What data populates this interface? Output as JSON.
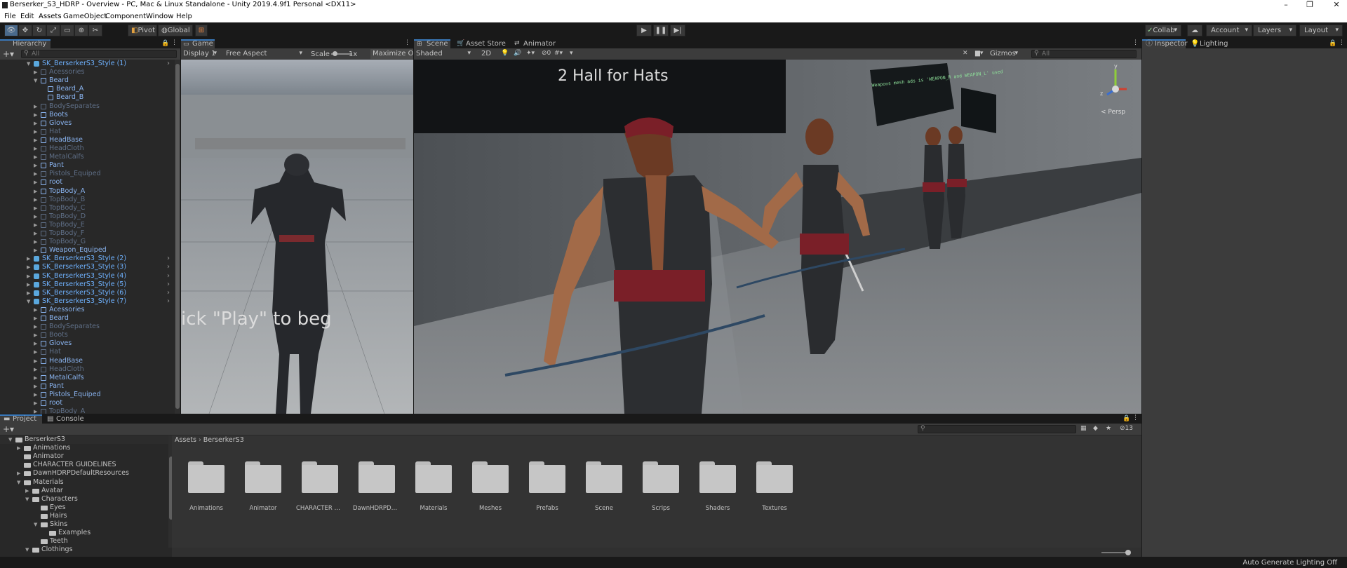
{
  "window": {
    "title": "Berserker_S3_HDRP - Overview - PC, Mac & Linux Standalone - Unity 2019.4.9f1 Personal <DX11>",
    "controls": [
      "–",
      "❐",
      "✕"
    ]
  },
  "menu": [
    "File",
    "Edit",
    "Assets",
    "GameObject",
    "Component",
    "Window",
    "Help"
  ],
  "toolbar": {
    "pivot": "Pivot",
    "global": "Global",
    "collab": "Collab",
    "account": "Account",
    "layers": "Layers",
    "layout": "Layout"
  },
  "hierarchy": {
    "tab": "Hierarchy",
    "search_placeholder": "All",
    "rows": [
      {
        "label": "SK_BerserkerS3_Style (1)",
        "depth": 0,
        "kind": "pre",
        "arrow": "open"
      },
      {
        "label": "Acessories",
        "depth": 1,
        "kind": "dis",
        "arrow": "closed"
      },
      {
        "label": "Beard",
        "depth": 1,
        "kind": "chi",
        "arrow": "open"
      },
      {
        "label": "Beard_A",
        "depth": 2,
        "kind": "chi",
        "arrow": ""
      },
      {
        "label": "Beard_B",
        "depth": 2,
        "kind": "chi",
        "arrow": ""
      },
      {
        "label": "BodySeparates",
        "depth": 1,
        "kind": "dis",
        "arrow": "closed"
      },
      {
        "label": "Boots",
        "depth": 1,
        "kind": "chi",
        "arrow": "closed"
      },
      {
        "label": "Gloves",
        "depth": 1,
        "kind": "chi",
        "arrow": "closed"
      },
      {
        "label": "Hat",
        "depth": 1,
        "kind": "dis",
        "arrow": "closed"
      },
      {
        "label": "HeadBase",
        "depth": 1,
        "kind": "chi",
        "arrow": "closed"
      },
      {
        "label": "HeadCloth",
        "depth": 1,
        "kind": "dis",
        "arrow": "closed"
      },
      {
        "label": "MetalCalfs",
        "depth": 1,
        "kind": "dis",
        "arrow": "closed"
      },
      {
        "label": "Pant",
        "depth": 1,
        "kind": "chi",
        "arrow": "closed"
      },
      {
        "label": "Pistols_Equiped",
        "depth": 1,
        "kind": "dis",
        "arrow": "closed"
      },
      {
        "label": "root",
        "depth": 1,
        "kind": "chi",
        "arrow": "closed"
      },
      {
        "label": "TopBody_A",
        "depth": 1,
        "kind": "chi",
        "arrow": "closed"
      },
      {
        "label": "TopBody_B",
        "depth": 1,
        "kind": "dis",
        "arrow": "closed"
      },
      {
        "label": "TopBody_C",
        "depth": 1,
        "kind": "dis",
        "arrow": "closed"
      },
      {
        "label": "TopBody_D",
        "depth": 1,
        "kind": "dis",
        "arrow": "closed"
      },
      {
        "label": "TopBody_E",
        "depth": 1,
        "kind": "dis",
        "arrow": "closed"
      },
      {
        "label": "TopBody_F",
        "depth": 1,
        "kind": "dis",
        "arrow": "closed"
      },
      {
        "label": "TopBody_G",
        "depth": 1,
        "kind": "dis",
        "arrow": "closed"
      },
      {
        "label": "Weapon_Equiped",
        "depth": 1,
        "kind": "chi",
        "arrow": "closed"
      },
      {
        "label": "SK_BerserkerS3_Style (2)",
        "depth": 0,
        "kind": "pre",
        "arrow": "closed"
      },
      {
        "label": "SK_BerserkerS3_Style (3)",
        "depth": 0,
        "kind": "pre",
        "arrow": "closed"
      },
      {
        "label": "SK_BerserkerS3_Style (4)",
        "depth": 0,
        "kind": "pre",
        "arrow": "closed"
      },
      {
        "label": "SK_BerserkerS3_Style (5)",
        "depth": 0,
        "kind": "pre",
        "arrow": "closed"
      },
      {
        "label": "SK_BerserkerS3_Style (6)",
        "depth": 0,
        "kind": "pre",
        "arrow": "closed"
      },
      {
        "label": "SK_BerserkerS3_Style (7)",
        "depth": 0,
        "kind": "pre",
        "arrow": "open"
      },
      {
        "label": "Acessories",
        "depth": 1,
        "kind": "chi",
        "arrow": "closed"
      },
      {
        "label": "Beard",
        "depth": 1,
        "kind": "chi",
        "arrow": "closed"
      },
      {
        "label": "BodySeparates",
        "depth": 1,
        "kind": "dis",
        "arrow": "closed"
      },
      {
        "label": "Boots",
        "depth": 1,
        "kind": "dis",
        "arrow": "closed"
      },
      {
        "label": "Gloves",
        "depth": 1,
        "kind": "chi",
        "arrow": "closed"
      },
      {
        "label": "Hat",
        "depth": 1,
        "kind": "dis",
        "arrow": "closed"
      },
      {
        "label": "HeadBase",
        "depth": 1,
        "kind": "chi",
        "arrow": "closed"
      },
      {
        "label": "HeadCloth",
        "depth": 1,
        "kind": "dis",
        "arrow": "closed"
      },
      {
        "label": "MetalCalfs",
        "depth": 1,
        "kind": "chi",
        "arrow": "closed"
      },
      {
        "label": "Pant",
        "depth": 1,
        "kind": "chi",
        "arrow": "closed"
      },
      {
        "label": "Pistols_Equiped",
        "depth": 1,
        "kind": "chi",
        "arrow": "closed"
      },
      {
        "label": "root",
        "depth": 1,
        "kind": "chi",
        "arrow": "closed"
      },
      {
        "label": "TopBody_A",
        "depth": 1,
        "kind": "dis",
        "arrow": "closed"
      }
    ]
  },
  "game": {
    "tab": "Game",
    "display": "Display 1",
    "aspect": "Free Aspect",
    "scale_label": "Scale",
    "scale_value": "1x",
    "maximize": "Maximize On",
    "overlay_text": "ick \"Play\" to beg"
  },
  "scene": {
    "tabs": [
      "Scene",
      "Asset Store",
      "Animator"
    ],
    "shading": "Shaded",
    "mode_2d": "2D",
    "hidden_count": "0",
    "gizmos": "Gizmos",
    "search_placeholder": "All",
    "persp": "< Persp",
    "banner": "2 Hall for Hats",
    "board_text": "Weapons mesh ads is 'WEAPON_R and WEAPON_L' used",
    "axis_y": "y",
    "axis_z": "z"
  },
  "inspector": {
    "tabs": [
      "Inspector",
      "Lighting"
    ]
  },
  "project": {
    "tabs": [
      "Project",
      "Console"
    ],
    "tree": [
      {
        "label": "BerserkerS3",
        "depth": 0,
        "arrow": "open"
      },
      {
        "label": "Animations",
        "depth": 1,
        "arrow": "closed"
      },
      {
        "label": "Animator",
        "depth": 1,
        "arrow": ""
      },
      {
        "label": "CHARACTER GUIDELINES",
        "depth": 1,
        "arrow": ""
      },
      {
        "label": "DawnHDRPDefaultResources",
        "depth": 1,
        "arrow": "closed"
      },
      {
        "label": "Materials",
        "depth": 1,
        "arrow": "open"
      },
      {
        "label": "Avatar",
        "depth": 2,
        "arrow": "closed"
      },
      {
        "label": "Characters",
        "depth": 2,
        "arrow": "open"
      },
      {
        "label": "Eyes",
        "depth": 3,
        "arrow": ""
      },
      {
        "label": "Hairs",
        "depth": 3,
        "arrow": ""
      },
      {
        "label": "Skins",
        "depth": 3,
        "arrow": "open"
      },
      {
        "label": "Examples",
        "depth": 4,
        "arrow": ""
      },
      {
        "label": "Teeth",
        "depth": 3,
        "arrow": ""
      },
      {
        "label": "Clothings",
        "depth": 2,
        "arrow": "open"
      }
    ],
    "breadcrumb": [
      "Assets",
      "BerserkerS3"
    ],
    "filter_count": "13",
    "folders": [
      "Animations",
      "Animator",
      "CHARACTER GUI...",
      "DawnHDRPDefaul...",
      "Materials",
      "Meshes",
      "Prefabs",
      "Scene",
      "Scrips",
      "Shaders",
      "Textures"
    ]
  },
  "status": {
    "right": "Auto Generate Lighting Off"
  },
  "colors": {
    "accent": "#3a79bb",
    "prefab": "#6fb2ff",
    "panel": "#282828",
    "tab_active": "#3c3c3c"
  }
}
